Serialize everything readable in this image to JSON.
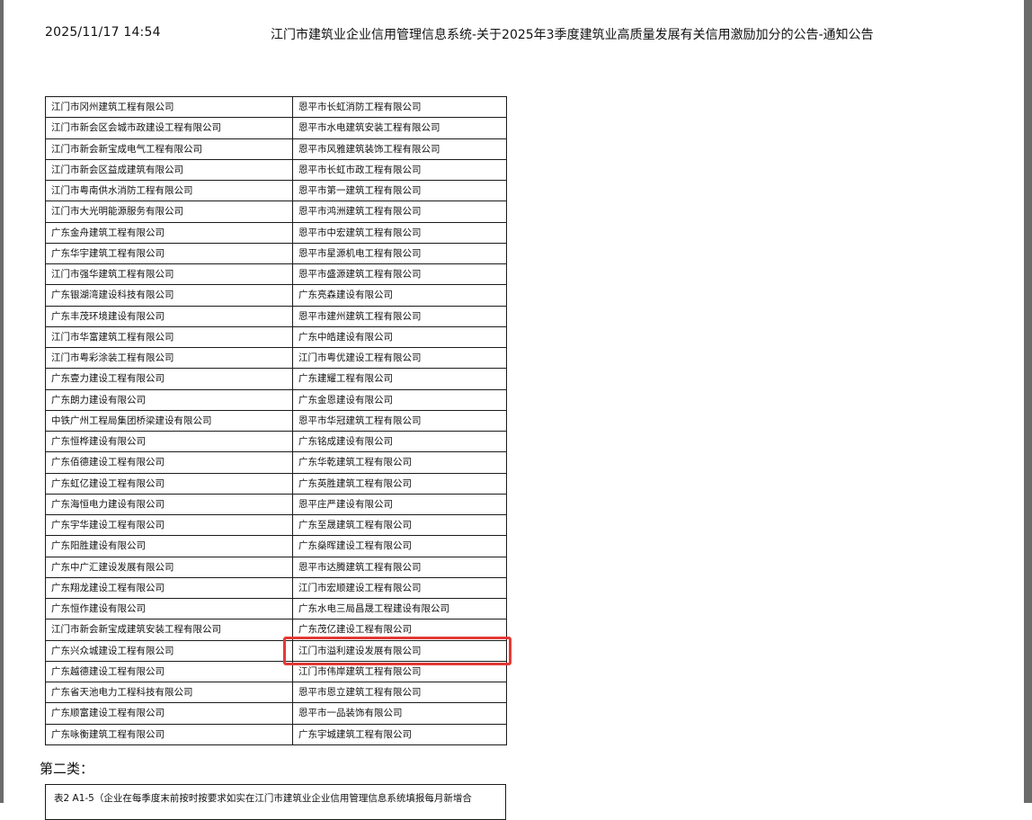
{
  "header": {
    "datetime": "2025/11/17 14:54",
    "title": "江门市建筑业企业信用管理信息系统-关于2025年3季度建筑业高质量发展有关信用激励加分的公告-通知公告"
  },
  "table": {
    "rows": [
      [
        "江门市冈州建筑工程有限公司",
        "恩平市长虹消防工程有限公司"
      ],
      [
        "江门市新会区会城市政建设工程有限公司",
        "恩平市水电建筑安装工程有限公司"
      ],
      [
        "江门市新会新宝成电气工程有限公司",
        "恩平市风雅建筑装饰工程有限公司"
      ],
      [
        "江门市新会区益成建筑有限公司",
        "恩平市长虹市政工程有限公司"
      ],
      [
        "江门市粤南供水消防工程有限公司",
        "恩平市第一建筑工程有限公司"
      ],
      [
        "江门市大光明能源服务有限公司",
        "恩平市鸿洲建筑工程有限公司"
      ],
      [
        "广东金舟建筑工程有限公司",
        "恩平市中宏建筑工程有限公司"
      ],
      [
        "广东华宇建筑工程有限公司",
        "恩平市星源机电工程有限公司"
      ],
      [
        "江门市强华建筑工程有限公司",
        "恩平市盛源建筑工程有限公司"
      ],
      [
        "广东银湖湾建设科技有限公司",
        "广东亮森建设有限公司"
      ],
      [
        "广东丰茂环境建设有限公司",
        "恩平市建州建筑工程有限公司"
      ],
      [
        "江门市华富建筑工程有限公司",
        "广东中皓建设有限公司"
      ],
      [
        "江门市粤彩涂装工程有限公司",
        "江门市粤优建设工程有限公司"
      ],
      [
        "广东壹力建设工程有限公司",
        "广东建耀工程有限公司"
      ],
      [
        "广东朗力建设有限公司",
        "广东金恩建设有限公司"
      ],
      [
        "中铁广州工程局集团桥梁建设有限公司",
        "恩平市华冠建筑工程有限公司"
      ],
      [
        "广东恒桦建设有限公司",
        "广东铭成建设有限公司"
      ],
      [
        "广东佰德建设工程有限公司",
        "广东华乾建筑工程有限公司"
      ],
      [
        "广东虹亿建设工程有限公司",
        "广东英胜建筑工程有限公司"
      ],
      [
        "广东海恒电力建设有限公司",
        "恩平庄严建设有限公司"
      ],
      [
        "广东宇华建设工程有限公司",
        "广东至晟建筑工程有限公司"
      ],
      [
        "广东阳胜建设有限公司",
        "广东燊晖建设工程有限公司"
      ],
      [
        "广东中广汇建设发展有限公司",
        "恩平市达腾建筑工程有限公司"
      ],
      [
        "广东翔龙建设工程有限公司",
        "江门市宏顺建设工程有限公司"
      ],
      [
        "广东恒作建设有限公司",
        "广东水电三局昌晟工程建设有限公司"
      ],
      [
        "江门市新会新宝成建筑安装工程有限公司",
        "广东茂亿建设工程有限公司"
      ],
      [
        "广东兴众城建设工程有限公司",
        "江门市溢利建设发展有限公司"
      ],
      [
        "广东越德建设工程有限公司",
        "江门市伟岸建筑工程有限公司"
      ],
      [
        "广东省天池电力工程科技有限公司",
        "恩平市恩立建筑工程有限公司"
      ],
      [
        "广东顺富建设工程有限公司",
        "恩平市一品装饰有限公司"
      ],
      [
        "广东咏衡建筑工程有限公司",
        "广东宇城建筑工程有限公司"
      ]
    ]
  },
  "highlight_color": "#e53935",
  "section": {
    "label": "第二类："
  },
  "table2": {
    "caption": "表2  A1-5（企业在每季度末前按时按要求如实在江门市建筑业企业信用管理信息系统填报每月新增合"
  }
}
